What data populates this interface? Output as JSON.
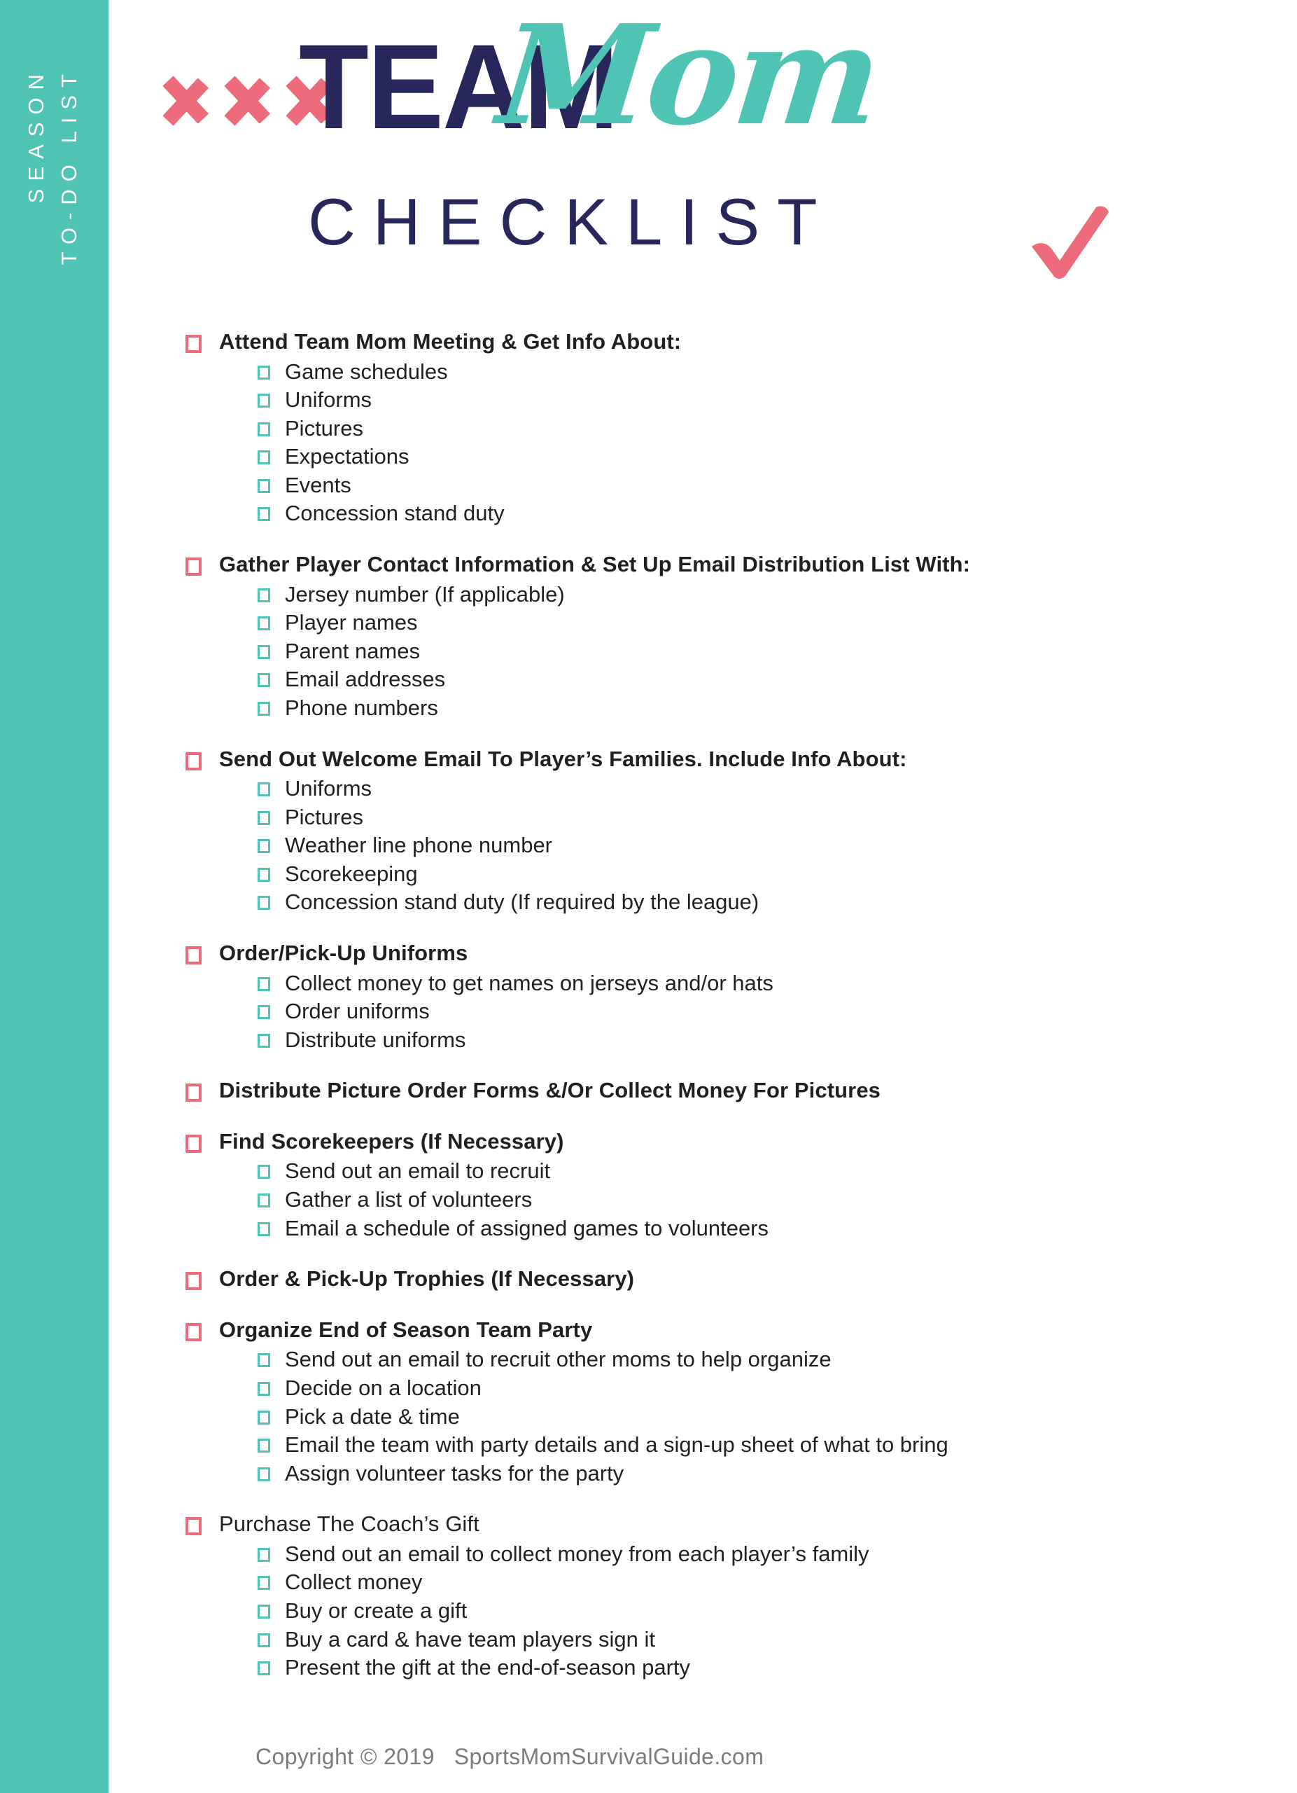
{
  "theme": {
    "teal": "#4FC3B4",
    "coral": "#EE6B7C",
    "navy": "#27275B",
    "text": "#231f20",
    "footer_gray": "#7b7b7b",
    "background": "#ffffff"
  },
  "sidebar": {
    "line1": "SEASON",
    "line2": "TO-DO LIST"
  },
  "header": {
    "title_bold": "TEAM",
    "title_script": "Mom",
    "subtitle": "CHECKLIST",
    "chevron_count": 3,
    "checkmark_icon": "checkmark-icon"
  },
  "checklist": {
    "sections": [
      {
        "label": "Attend Team Mom Meeting & Get Info About:",
        "bold": true,
        "subitems": [
          "Game schedules",
          "Uniforms",
          "Pictures",
          "Expectations",
          "Events",
          "Concession stand duty"
        ]
      },
      {
        "label": "Gather Player Contact Information & Set Up Email Distribution List With:",
        "bold": true,
        "subitems": [
          "Jersey number (If applicable)",
          "Player names",
          "Parent names",
          "Email addresses",
          "Phone numbers"
        ]
      },
      {
        "label": "Send Out Welcome Email To Player’s Families. Include Info About:",
        "bold": true,
        "subitems": [
          "Uniforms",
          "Pictures",
          "Weather line phone number",
          "Scorekeeping",
          "Concession stand duty (If required by the league)"
        ]
      },
      {
        "label": "Order/Pick-Up Uniforms",
        "bold": true,
        "subitems": [
          "Collect money to get names on jerseys and/or hats",
          "Order uniforms",
          "Distribute uniforms"
        ]
      },
      {
        "label": "Distribute Picture Order Forms &/Or Collect Money For Pictures",
        "bold": true,
        "subitems": []
      },
      {
        "label": "Find Scorekeepers (If Necessary)",
        "bold": true,
        "subitems": [
          "Send out an email to recruit",
          "Gather a list of volunteers",
          "Email a schedule of assigned games to volunteers"
        ]
      },
      {
        "label": "Order & Pick-Up Trophies (If Necessary)",
        "bold": true,
        "subitems": []
      },
      {
        "label": "Organize End of Season Team Party",
        "bold": true,
        "subitems": [
          "Send out an email to recruit other moms to help organize",
          "Decide on a location",
          "Pick a date & time",
          "Email the team with party details and a sign-up sheet of what to bring",
          "Assign volunteer tasks for the party"
        ]
      },
      {
        "label": "Purchase The Coach’s Gift",
        "bold": false,
        "subitems": [
          "Send out an email to collect money from each player’s family",
          "Collect money",
          "Buy or create a gift",
          "Buy a card & have team players sign it",
          "Present the gift at the end-of-season party"
        ]
      }
    ]
  },
  "footer": {
    "text": "Copyright © 2019   SportsMomSurvivalGuide.com"
  }
}
